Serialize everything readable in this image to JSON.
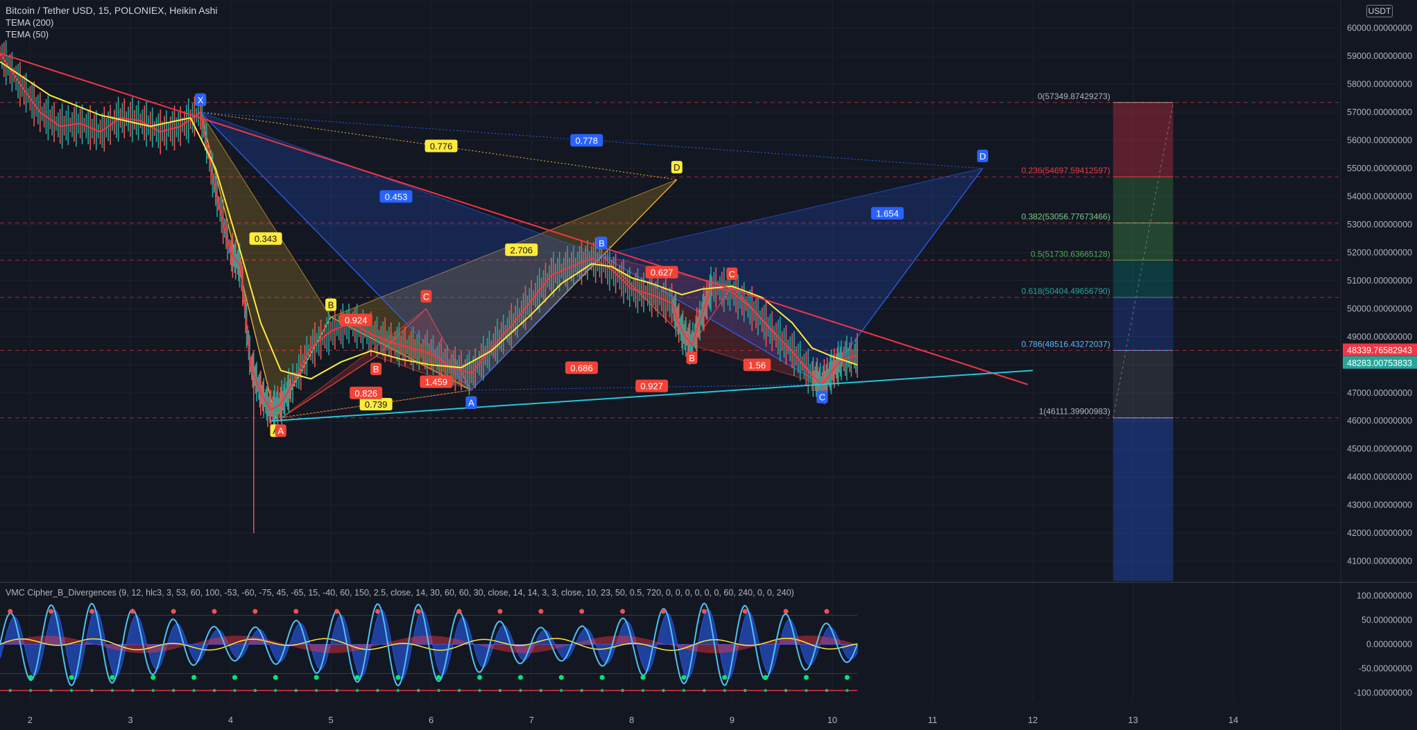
{
  "header": {
    "title": "Bitcoin / Tether USD, 15, POLONIEX, Heikin Ashi",
    "tema200": "TEMA (200)",
    "tema50": "TEMA (50)",
    "currency": "USDT"
  },
  "colors": {
    "background": "#131722",
    "grid": "#1e222d",
    "price": "#f23645",
    "tema200": "#ffeb3b",
    "trend": "#f23645",
    "support": "#26c6da",
    "harmonic_yellow": "#fbc02d",
    "harmonic_red": "#f44336",
    "harmonic_blue": "#2962ff"
  },
  "chart_data": [
    {
      "type": "line",
      "name": "price",
      "x_axis": {
        "ticks": [
          2,
          3,
          4,
          5,
          6,
          7,
          8,
          9,
          10,
          11,
          12,
          13,
          14
        ],
        "range": [
          1.7,
          15.05
        ]
      },
      "y_axis": {
        "range": [
          40300,
          61000
        ],
        "ticks": [
          41000,
          42000,
          43000,
          44000,
          45000,
          46000,
          47000,
          48000,
          49000,
          50000,
          51000,
          52000,
          53000,
          54000,
          55000,
          56000,
          57000,
          58000,
          59000,
          60000,
          61000
        ],
        "tick_labels": [
          "41000.00000000",
          "42000.00000000",
          "43000.00000000",
          "44000.00000000",
          "45000.00000000",
          "46000.00000000",
          "47000.00000000",
          "48000.00000000",
          "49000.00000000",
          "50000.00000000",
          "51000.00000000",
          "52000.00000000",
          "53000.00000000",
          "54000.00000000",
          "55000.00000000",
          "56000.00000000",
          "57000.00000000",
          "58000.00000000",
          "59000.00000000",
          "60000.00000000",
          "61000.00000000"
        ]
      },
      "price_labels": [
        {
          "value": 48340,
          "text": "48339.76582943",
          "color": "#f23645"
        },
        {
          "value": 48283,
          "text": "48283.00753833",
          "color": "#26a69a"
        }
      ],
      "series": [
        {
          "name": "Heikin Ashi",
          "x": [
            1.7,
            1.9,
            2.1,
            2.3,
            2.5,
            2.7,
            2.9,
            3.1,
            3.3,
            3.5,
            3.7,
            3.85,
            4.0,
            4.1,
            4.2,
            4.3,
            4.4,
            4.5,
            4.6,
            4.8,
            5.0,
            5.2,
            5.4,
            5.6,
            5.8,
            6.0,
            6.2,
            6.4,
            6.6,
            6.8,
            7.0,
            7.2,
            7.4,
            7.6,
            7.8,
            8.0,
            8.2,
            8.4,
            8.5,
            8.6,
            8.7,
            8.8,
            9.0,
            9.2,
            9.4,
            9.6,
            9.8,
            9.9,
            10.0,
            10.1,
            10.25
          ],
          "values": [
            59100,
            58000,
            57000,
            56500,
            56600,
            56300,
            56800,
            56700,
            56300,
            56500,
            57000,
            54200,
            52000,
            51500,
            48000,
            47000,
            46400,
            46600,
            47200,
            48600,
            49200,
            49500,
            49100,
            48800,
            48600,
            48400,
            47900,
            47700,
            48600,
            49400,
            50300,
            51200,
            51500,
            51800,
            51400,
            50700,
            50500,
            50200,
            49200,
            48700,
            49800,
            50800,
            50600,
            50000,
            49200,
            48500,
            47600,
            47300,
            47800,
            48200,
            48340
          ]
        },
        {
          "name": "TEMA 200",
          "x": [
            1.7,
            2.2,
            2.7,
            3.2,
            3.6,
            3.85,
            4.1,
            4.3,
            4.5,
            4.8,
            5.1,
            5.4,
            5.7,
            6.0,
            6.3,
            6.6,
            7.0,
            7.3,
            7.6,
            7.8,
            8.0,
            8.2,
            8.5,
            8.7,
            9.0,
            9.3,
            9.6,
            9.8,
            10.0,
            10.25
          ],
          "values": [
            58800,
            57600,
            56900,
            56500,
            56800,
            55000,
            52000,
            49500,
            47800,
            47500,
            48100,
            48500,
            48200,
            48000,
            47900,
            48500,
            49800,
            50900,
            51600,
            51500,
            51100,
            50900,
            50500,
            50700,
            50800,
            50400,
            49500,
            48600,
            48300,
            48000
          ]
        }
      ],
      "trendlines": [
        {
          "name": "resistance",
          "x1": 1.7,
          "y1": 59100,
          "x2": 11.95,
          "y2": 47300
        },
        {
          "name": "support",
          "x1": 4.4,
          "y1": 46000,
          "x2": 12.0,
          "y2": 47800
        }
      ],
      "horizontal_levels": [
        57349.87,
        54697.59,
        53056.78,
        51730.64,
        50404.5,
        48516.43,
        46111.4
      ],
      "fib_levels": [
        {
          "text": "0(57349.87429273)",
          "value": 57349.87,
          "color": "#b2b5be"
        },
        {
          "text": "0.236(54697.59412597)",
          "value": 54697.59,
          "color": "#f23645"
        },
        {
          "text": "0.382(53056.77673466)",
          "value": 53056.78,
          "color": "#81c784"
        },
        {
          "text": "0.5(51730.63665128)",
          "value": 51730.64,
          "color": "#4caf50"
        },
        {
          "text": "0.618(50404.49656790)",
          "value": 50404.5,
          "color": "#26a69a"
        },
        {
          "text": "0.786(48516.43272037)",
          "value": 48516.43,
          "color": "#64b5f6"
        },
        {
          "text": "1(46111.39900983)",
          "value": 46111.4,
          "color": "#b2b5be"
        }
      ],
      "harmonic_patterns": [
        {
          "color": "#fbc02d",
          "points": [
            {
              "label": "X",
              "x": 3.7,
              "y": 57000
            },
            {
              "label": "A",
              "x": 4.45,
              "y": 46100
            },
            {
              "label": "B",
              "x": 5.0,
              "y": 49700
            },
            {
              "label": "C",
              "x": 6.4,
              "y": 47100
            },
            {
              "label": "D",
              "x": 8.45,
              "y": 54600
            }
          ],
          "ratios": [
            {
              "text": "0.343",
              "x": 4.35,
              "y": 52500
            },
            {
              "text": "0.739",
              "x": 5.45,
              "y": 46600
            },
            {
              "text": "2.706",
              "x": 6.9,
              "y": 52100
            },
            {
              "text": "0.776",
              "x": 6.1,
              "y": 55800
            }
          ]
        },
        {
          "color": "#f44336",
          "points": [
            {
              "label": "A",
              "x": 7.7,
              "y": 51900
            },
            {
              "label": "B",
              "x": 8.6,
              "y": 48700
            },
            {
              "label": "C",
              "x": 9.0,
              "y": 50800
            },
            {
              "label": "D",
              "x": 9.9,
              "y": 47300
            }
          ],
          "ratios": [
            {
              "text": "0.627",
              "x": 8.3,
              "y": 51300
            },
            {
              "text": "1.56",
              "x": 9.25,
              "y": 48000
            },
            {
              "text": "0.686",
              "x": 7.5,
              "y": 47900
            },
            {
              "text": "0.927",
              "x": 8.2,
              "y": 47250
            }
          ]
        },
        {
          "color": "#f44336",
          "points": [
            {
              "label": "A",
              "x": 4.5,
              "y": 46100
            },
            {
              "label": "B",
              "x": 5.45,
              "y": 48300
            },
            {
              "label": "C",
              "x": 5.95,
              "y": 50000
            },
            {
              "label": "D",
              "x": 6.4,
              "y": 47100
            }
          ],
          "ratios": [
            {
              "text": "0.924",
              "x": 5.25,
              "y": 49600
            },
            {
              "text": "0.826",
              "x": 5.35,
              "y": 47000
            },
            {
              "text": "1.459",
              "x": 6.05,
              "y": 47400
            }
          ]
        },
        {
          "color": "#2962ff",
          "points": [
            {
              "label": "X",
              "x": 3.7,
              "y": 57000
            },
            {
              "label": "A",
              "x": 6.4,
              "y": 47100
            },
            {
              "label": "B",
              "x": 7.7,
              "y": 51900
            },
            {
              "label": "C",
              "x": 9.9,
              "y": 47300
            },
            {
              "label": "D",
              "x": 11.5,
              "y": 55000
            }
          ],
          "ratios": [
            {
              "text": "0.453",
              "x": 5.65,
              "y": 54000
            },
            {
              "text": "0.778",
              "x": 7.55,
              "y": 56000
            },
            {
              "text": "1.654",
              "x": 10.55,
              "y": 53400
            }
          ]
        }
      ],
      "long_position": {
        "x_start": 12.8,
        "x_end": 13.4,
        "top": 57349.87,
        "bottom": 40300
      }
    },
    {
      "type": "line",
      "name": "VMC Cipher_B_Divergences",
      "title": "VMC Cipher_B_Divergences (9, 12, hlc3, 3, 53, 60, 100, -53, -60, -75, 45, -65, 15, -40, 60, 150, 2.5, close, 14, 30, 60, 60, 30, close, 14, 14, 3, 3, close, 10, 23, 50, 0.5, 720, 0, 0, 0, 0, 0, 0, 60, 240, 0, 0, 240)",
      "y_axis": {
        "range": [
          -115,
          125
        ],
        "ticks": [
          100,
          50,
          0,
          -50,
          -100
        ],
        "tick_labels": [
          "100.00000000",
          "50.00000000",
          "0.00000000",
          "-50.00000000",
          "-100.00000000"
        ]
      },
      "x_range": [
        1.7,
        10.25
      ],
      "oscillation": {
        "cycles": 42,
        "wave_amplitude": 85,
        "ref_lines": [
          60,
          -60,
          -95
        ]
      }
    }
  ]
}
